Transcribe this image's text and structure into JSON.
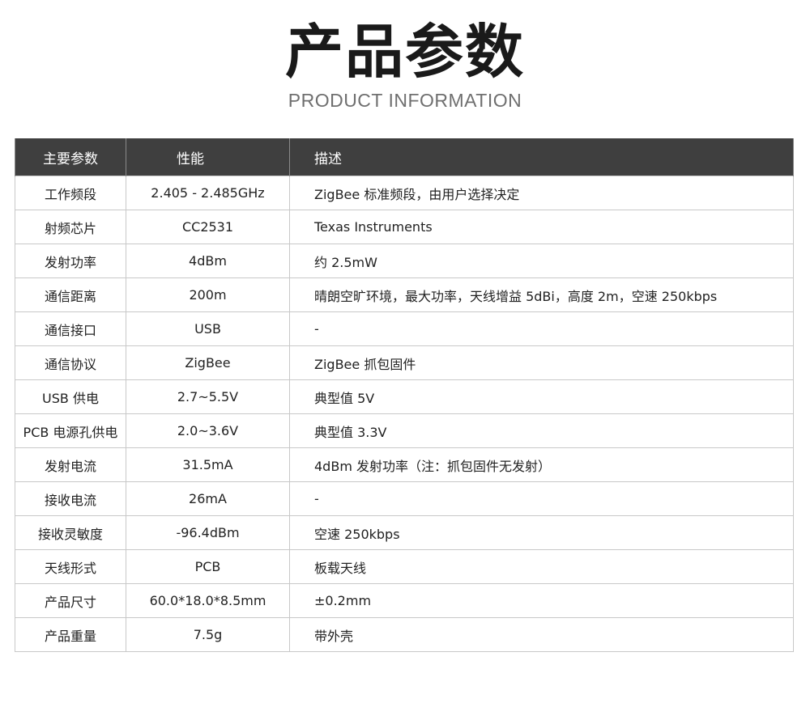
{
  "header": {
    "title": "产品参数",
    "subtitle": "PRODUCT INFORMATION"
  },
  "table": {
    "columns": [
      "主要参数",
      "性能",
      "描述"
    ],
    "rows": [
      {
        "param": "工作频段",
        "performance": "2.405 - 2.485GHz",
        "description": "ZigBee 标准频段，由用户选择决定"
      },
      {
        "param": "射频芯片",
        "performance": "CC2531",
        "description": "Texas Instruments"
      },
      {
        "param": "发射功率",
        "performance": "4dBm",
        "description": "约 2.5mW"
      },
      {
        "param": "通信距离",
        "performance": "200m",
        "description": "晴朗空旷环境，最大功率，天线增益 5dBi，高度 2m，空速 250kbps"
      },
      {
        "param": "通信接口",
        "performance": "USB",
        "description": "-"
      },
      {
        "param": "通信协议",
        "performance": "ZigBee",
        "description": "ZigBee 抓包固件"
      },
      {
        "param": "USB 供电",
        "performance": "2.7~5.5V",
        "description": "典型值 5V"
      },
      {
        "param": "PCB 电源孔供电",
        "performance": "2.0~3.6V",
        "description": "典型值 3.3V"
      },
      {
        "param": "发射电流",
        "performance": "31.5mA",
        "description": "4dBm 发射功率（注：抓包固件无发射）"
      },
      {
        "param": "接收电流",
        "performance": "26mA",
        "description": "-"
      },
      {
        "param": "接收灵敏度",
        "performance": "-96.4dBm",
        "description": "空速 250kbps"
      },
      {
        "param": "天线形式",
        "performance": "PCB",
        "description": "板载天线"
      },
      {
        "param": "产品尺寸",
        "performance": "60.0*18.0*8.5mm",
        "description": "±0.2mm"
      },
      {
        "param": "产品重量",
        "performance": "7.5g",
        "description": "带外壳"
      }
    ]
  },
  "colors": {
    "header_background": "#3f3f3f",
    "header_text": "#ffffff",
    "border": "#c8c8c8",
    "title": "#1a1a1a",
    "subtitle": "#6f6f6f"
  }
}
